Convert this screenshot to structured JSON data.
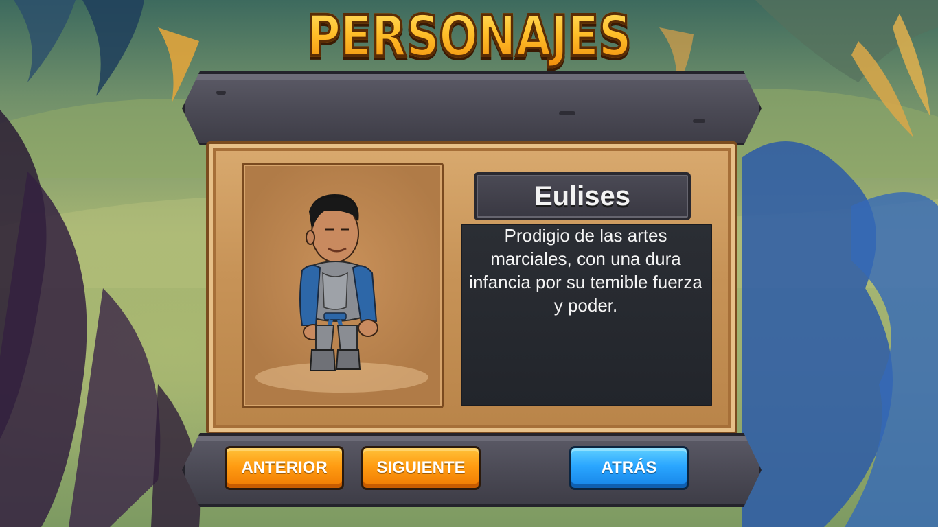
{
  "screen": {
    "title": "PERSONAJES"
  },
  "character": {
    "name": "Eulises",
    "description": "Prodigio de las artes marciales, con una dura infancia por su temible fuerza y poder.",
    "portrait_icon": "fighter-character-sprite"
  },
  "buttons": {
    "previous": "ANTERIOR",
    "next": "SIGUIENTE",
    "back": "ATRÁS"
  },
  "colors": {
    "title_orange": "#ffb21e",
    "button_orange": "#ff9c12",
    "button_blue": "#2aa6ff",
    "panel_wood": "#c79357",
    "stone_bar": "#4a4954"
  }
}
